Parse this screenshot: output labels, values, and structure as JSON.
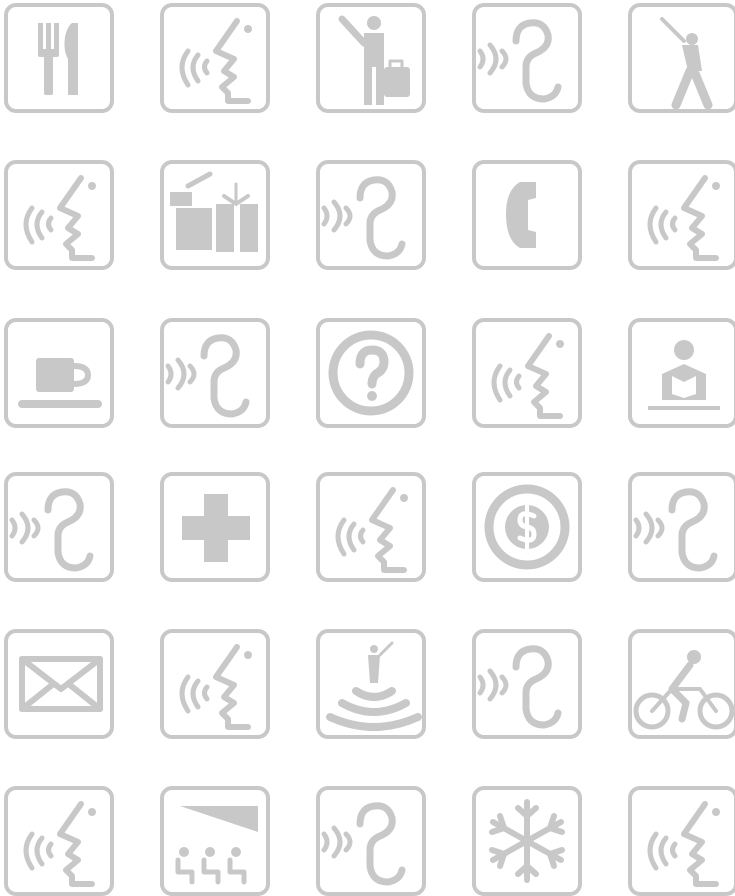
{
  "colors": {
    "icon_fill": "#c8c8c8",
    "tile_border": "#c8c8c8",
    "background": "#ffffff"
  },
  "grid": {
    "rows": [
      [
        "restaurant",
        "speaking",
        "hail-taxi",
        "hearing",
        "baseball"
      ],
      [
        "speaking",
        "gift-shop",
        "hearing",
        "telephone",
        "speaking"
      ],
      [
        "coffee",
        "hearing",
        "information",
        "speaking",
        "reading"
      ],
      [
        "hearing",
        "first-aid",
        "speaking",
        "currency-exchange",
        "hearing"
      ],
      [
        "mail",
        "speaking",
        "observation-point",
        "hearing",
        "bicycling"
      ],
      [
        "speaking",
        "theater",
        "hearing",
        "snowflake",
        "speaking"
      ]
    ]
  }
}
